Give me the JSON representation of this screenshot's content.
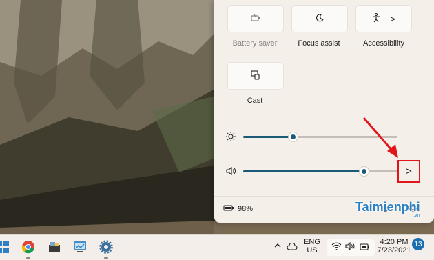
{
  "quick_settings": {
    "tiles": [
      {
        "label": "Battery saver",
        "icon": "battery-saver-icon",
        "enabled": false
      },
      {
        "label": "Focus assist",
        "icon": "moon-icon",
        "enabled": true
      },
      {
        "label": "Accessibility",
        "icon": "accessibility-icon",
        "chevron": ">",
        "enabled": true
      },
      {
        "label": "Cast",
        "icon": "cast-icon",
        "enabled": true
      }
    ],
    "brightness": {
      "icon": "sun-icon",
      "level_percent": 32
    },
    "volume": {
      "icon": "speaker-icon",
      "level_percent": 78,
      "expand_label": ">"
    },
    "battery_text": "98%",
    "footer_icons": [
      "edit-icon",
      "settings-icon"
    ]
  },
  "watermark": {
    "text": "Taimienphi",
    "suffix": ".vn"
  },
  "taskbar": {
    "apps": [
      "start-icon",
      "chrome-icon",
      "explorer-icon",
      "control-panel-icon",
      "settings-icon"
    ],
    "tray": {
      "language_top": "ENG",
      "language_bottom": "US",
      "time": "4:20 PM",
      "date": "7/23/2021",
      "notification_count": "13"
    }
  },
  "colors": {
    "accent": "#1a5a76",
    "highlight": "#e0161b",
    "panel": "#f4efe9"
  }
}
